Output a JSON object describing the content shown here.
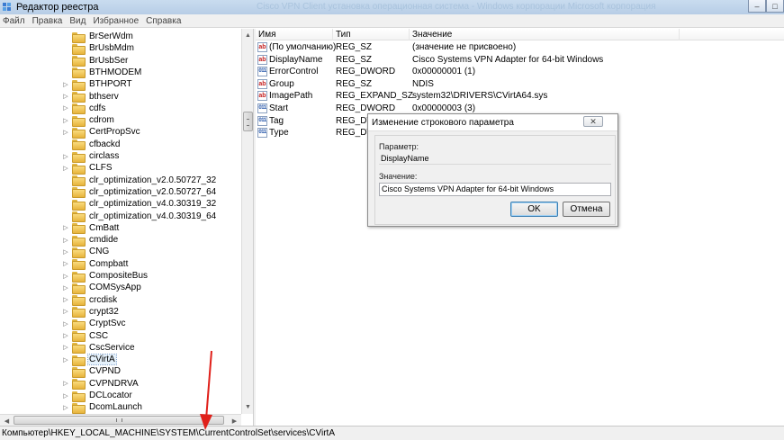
{
  "window": {
    "title": "Редактор реестра",
    "ghost_title": "Cisco VPN Client установка операционная система - Windows корпорации Microsoft корпорация"
  },
  "menu": [
    "Файл",
    "Правка",
    "Вид",
    "Избранное",
    "Справка"
  ],
  "tree": {
    "items": [
      {
        "label": "BrSerWdm",
        "expandable": false
      },
      {
        "label": "BrUsbMdm",
        "expandable": false
      },
      {
        "label": "BrUsbSer",
        "expandable": false
      },
      {
        "label": "BTHMODEM",
        "expandable": false
      },
      {
        "label": "BTHPORT",
        "expandable": true
      },
      {
        "label": "bthserv",
        "expandable": true
      },
      {
        "label": "cdfs",
        "expandable": true
      },
      {
        "label": "cdrom",
        "expandable": true
      },
      {
        "label": "CertPropSvc",
        "expandable": true
      },
      {
        "label": "cfbackd",
        "expandable": false
      },
      {
        "label": "circlass",
        "expandable": true
      },
      {
        "label": "CLFS",
        "expandable": true
      },
      {
        "label": "clr_optimization_v2.0.50727_32",
        "expandable": false
      },
      {
        "label": "clr_optimization_v2.0.50727_64",
        "expandable": false
      },
      {
        "label": "clr_optimization_v4.0.30319_32",
        "expandable": false
      },
      {
        "label": "clr_optimization_v4.0.30319_64",
        "expandable": false
      },
      {
        "label": "CmBatt",
        "expandable": true
      },
      {
        "label": "cmdide",
        "expandable": true
      },
      {
        "label": "CNG",
        "expandable": true
      },
      {
        "label": "Compbatt",
        "expandable": true
      },
      {
        "label": "CompositeBus",
        "expandable": true
      },
      {
        "label": "COMSysApp",
        "expandable": true
      },
      {
        "label": "crcdisk",
        "expandable": true
      },
      {
        "label": "crypt32",
        "expandable": true
      },
      {
        "label": "CryptSvc",
        "expandable": true
      },
      {
        "label": "CSC",
        "expandable": true
      },
      {
        "label": "CscService",
        "expandable": true
      },
      {
        "label": "CVirtA",
        "expandable": true,
        "selected": true
      },
      {
        "label": "CVPND",
        "expandable": false
      },
      {
        "label": "CVPNDRVA",
        "expandable": true
      },
      {
        "label": "DCLocator",
        "expandable": true
      },
      {
        "label": "DcomLaunch",
        "expandable": true
      }
    ]
  },
  "list": {
    "headers": {
      "name": "Имя",
      "type": "Тип",
      "value": "Значение"
    },
    "rows": [
      {
        "icon": "sz",
        "name": "(По умолчанию)",
        "type": "REG_SZ",
        "value": "(значение не присвоено)"
      },
      {
        "icon": "sz",
        "name": "DisplayName",
        "type": "REG_SZ",
        "value": "Cisco Systems VPN Adapter for 64-bit Windows"
      },
      {
        "icon": "dw",
        "name": "ErrorControl",
        "type": "REG_DWORD",
        "value": "0x00000001 (1)"
      },
      {
        "icon": "sz",
        "name": "Group",
        "type": "REG_SZ",
        "value": "NDIS"
      },
      {
        "icon": "sz",
        "name": "ImagePath",
        "type": "REG_EXPAND_SZ",
        "value": "system32\\DRIVERS\\CVirtA64.sys"
      },
      {
        "icon": "dw",
        "name": "Start",
        "type": "REG_DWORD",
        "value": "0x00000003 (3)"
      },
      {
        "icon": "dw",
        "name": "Tag",
        "type": "REG_DWO",
        "value": ""
      },
      {
        "icon": "dw",
        "name": "Type",
        "type": "REG_DW",
        "value": ""
      }
    ]
  },
  "statusbar": {
    "path": "Компьютер\\HKEY_LOCAL_MACHINE\\SYSTEM\\CurrentControlSet\\services\\CVirtA"
  },
  "dialog": {
    "title": "Изменение строкового параметра",
    "close_glyph": "✕",
    "param_label": "Параметр:",
    "param_value": "DisplayName",
    "value_label": "Значение:",
    "value_input": "Cisco Systems VPN Adapter for 64-bit Windows",
    "ok_label": "OK",
    "cancel_label": "Отмена"
  },
  "colors": {
    "annotation_arrow": "#e0201a",
    "selection": "#e5f1fb"
  },
  "glyphs": {
    "minimize": "–",
    "maximize": "□",
    "close": "✕",
    "expand": "▷",
    "up": "▲",
    "down": "▼",
    "left": "◀",
    "right": "▶",
    "sz_icon": "ab",
    "dw_icon": "011"
  }
}
